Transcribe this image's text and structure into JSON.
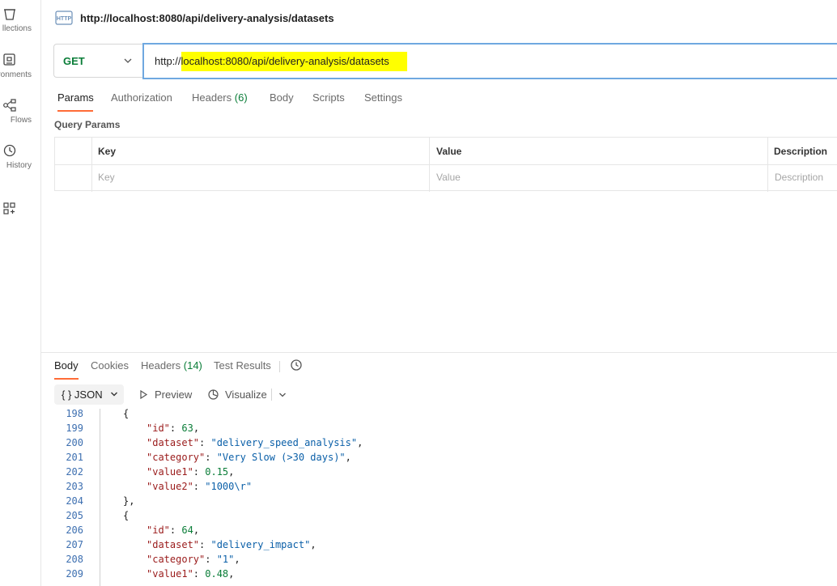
{
  "sidebar": {
    "items": [
      {
        "label": "llections",
        "icon": "collections-icon"
      },
      {
        "label": "ronments",
        "icon": "environments-icon"
      },
      {
        "label": "Flows",
        "icon": "flows-icon"
      },
      {
        "label": "History",
        "icon": "history-icon"
      },
      {
        "label": "",
        "icon": "configure-workbench-icon"
      }
    ]
  },
  "request": {
    "icon": "http-icon",
    "title": "http://localhost:8080/api/delivery-analysis/datasets",
    "method": "GET",
    "url_prefix": "http://",
    "url_highlighted": "localhost:8080/api/delivery-analysis/datasets",
    "highlight_color": "#ffff00",
    "tabs": [
      {
        "label": "Params"
      },
      {
        "label": "Authorization"
      },
      {
        "label": "Headers",
        "count": "(6)"
      },
      {
        "label": "Body"
      },
      {
        "label": "Scripts"
      },
      {
        "label": "Settings"
      }
    ],
    "active_tab": "Params"
  },
  "query_params": {
    "label": "Query Params",
    "headers": [
      "Key",
      "Value",
      "Description"
    ],
    "placeholders": [
      "Key",
      "Value",
      "Description"
    ]
  },
  "response": {
    "tabs": [
      {
        "label": "Body"
      },
      {
        "label": "Cookies"
      },
      {
        "label": "Headers",
        "count": "(14)"
      },
      {
        "label": "Test Results"
      }
    ],
    "active_tab": "Body",
    "format": {
      "braces": "{ }",
      "label": "JSON"
    },
    "preview_label": "Preview",
    "visualize_label": "Visualize",
    "code_lines": [
      {
        "n": "198",
        "indent": 0,
        "raw": "{"
      },
      {
        "n": "199",
        "indent": 1,
        "key": "\"id\"",
        "val": "63",
        "type": "num",
        "comma": ","
      },
      {
        "n": "200",
        "indent": 1,
        "key": "\"dataset\"",
        "val": "\"delivery_speed_analysis\"",
        "type": "str",
        "comma": ","
      },
      {
        "n": "201",
        "indent": 1,
        "key": "\"category\"",
        "val": "\"Very Slow (>30 days)\"",
        "type": "str",
        "comma": ","
      },
      {
        "n": "202",
        "indent": 1,
        "key": "\"value1\"",
        "val": "0.15",
        "type": "num",
        "comma": ","
      },
      {
        "n": "203",
        "indent": 1,
        "key": "\"value2\"",
        "val": "\"1000\\r\"",
        "type": "str",
        "comma": ""
      },
      {
        "n": "204",
        "indent": 0,
        "raw": "},"
      },
      {
        "n": "205",
        "indent": 0,
        "raw": "{"
      },
      {
        "n": "206",
        "indent": 1,
        "key": "\"id\"",
        "val": "64",
        "type": "num",
        "comma": ","
      },
      {
        "n": "207",
        "indent": 1,
        "key": "\"dataset\"",
        "val": "\"delivery_impact\"",
        "type": "str",
        "comma": ","
      },
      {
        "n": "208",
        "indent": 1,
        "key": "\"category\"",
        "val": "\"1\"",
        "type": "str",
        "comma": ","
      },
      {
        "n": "209",
        "indent": 1,
        "key": "\"value1\"",
        "val": "0.48",
        "type": "num",
        "comma": ","
      }
    ]
  },
  "colors": {
    "accent": "#ff6c37",
    "method_get": "#0a7d38",
    "url_focus_border": "#6fa8e0",
    "json_key": "#9a1b1b",
    "json_string": "#0a5fa8",
    "json_number": "#0a7d38",
    "line_number": "#3d6fb0"
  }
}
